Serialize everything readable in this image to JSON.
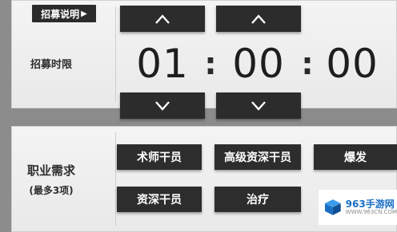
{
  "help": {
    "label": "招募说明"
  },
  "timer": {
    "label": "招募时限",
    "hours": "01",
    "minutes": "00",
    "seconds": "00",
    "separator": ":"
  },
  "jobs": {
    "label": "职业需求",
    "sublabel": "(最多3项)",
    "tags": [
      "术师干员",
      "高级资深干员",
      "爆发",
      "资深干员",
      "治疗"
    ]
  },
  "watermark": {
    "brand": "963手游网",
    "url": "WWW.963CN.COM"
  },
  "colors": {
    "panel": "#eeeeee",
    "button": "#2c2c2c",
    "text": "#1e1e1e",
    "brand": "#1a6fc4"
  },
  "icons": {
    "up": "chevron-up-icon",
    "down": "chevron-down-icon",
    "help_arrow": "triangle-right-icon"
  }
}
